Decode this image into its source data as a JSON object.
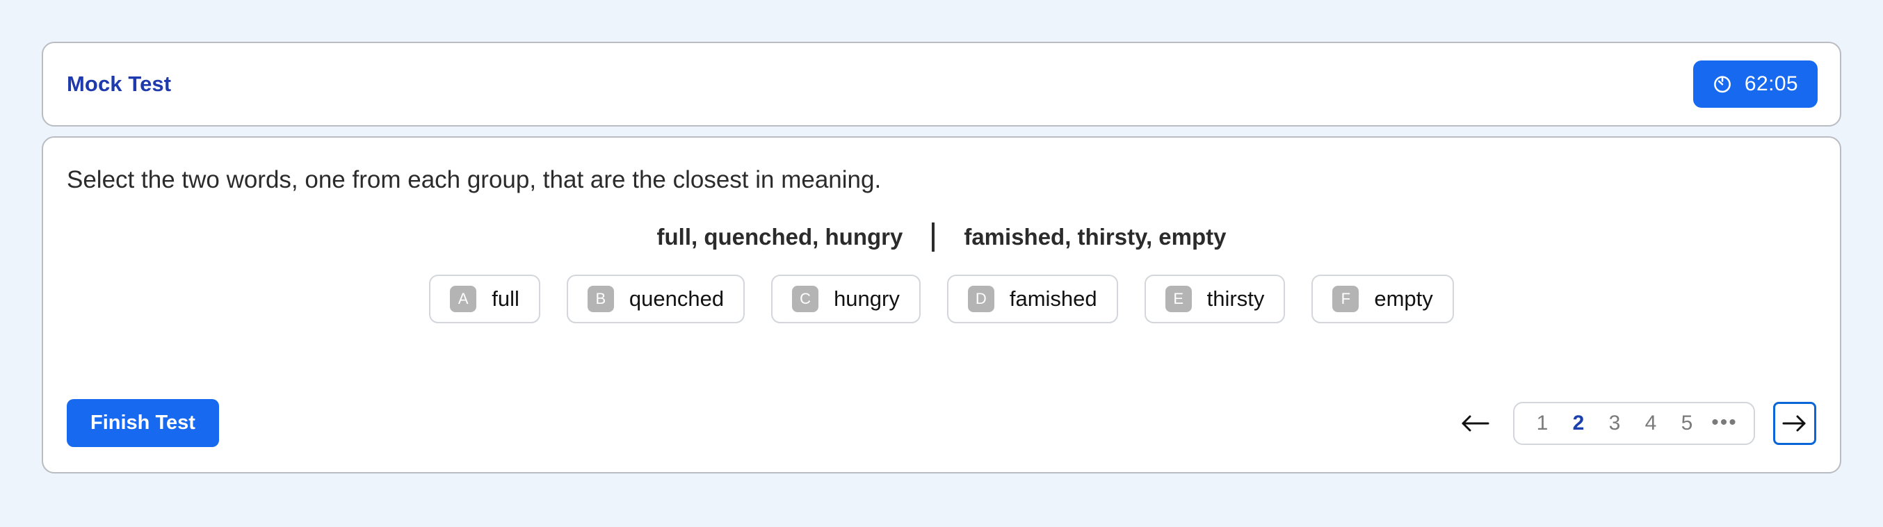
{
  "header": {
    "title": "Mock Test",
    "timer": {
      "icon": "timer-icon",
      "value": "62:05"
    }
  },
  "question": {
    "prompt": "Select the two words, one from each group, that are the closest in meaning.",
    "group_left": "full, quenched, hungry",
    "group_divider": "|",
    "group_right": "famished, thirsty, empty",
    "options": [
      {
        "key": "A",
        "label": "full"
      },
      {
        "key": "B",
        "label": "quenched"
      },
      {
        "key": "C",
        "label": "hungry"
      },
      {
        "key": "D",
        "label": "famished"
      },
      {
        "key": "E",
        "label": "thirsty"
      },
      {
        "key": "F",
        "label": "empty"
      }
    ]
  },
  "footer": {
    "finish_label": "Finish Test",
    "prev_icon": "arrow-left-icon",
    "next_icon": "arrow-right-icon",
    "pages": [
      {
        "label": "1",
        "active": false
      },
      {
        "label": "2",
        "active": true
      },
      {
        "label": "3",
        "active": false
      },
      {
        "label": "4",
        "active": false
      },
      {
        "label": "5",
        "active": false
      }
    ],
    "ellipsis": "•••"
  },
  "colors": {
    "page_background": "#edf4fc",
    "card_border": "#b9bcc0",
    "accent_blue": "#1769f0",
    "title_blue": "#1e3aad",
    "active_page_blue": "#1a3faf",
    "badge_gray": "#b4b4b4",
    "option_border": "#d3d6da",
    "next_border_blue": "#0a66d6"
  }
}
